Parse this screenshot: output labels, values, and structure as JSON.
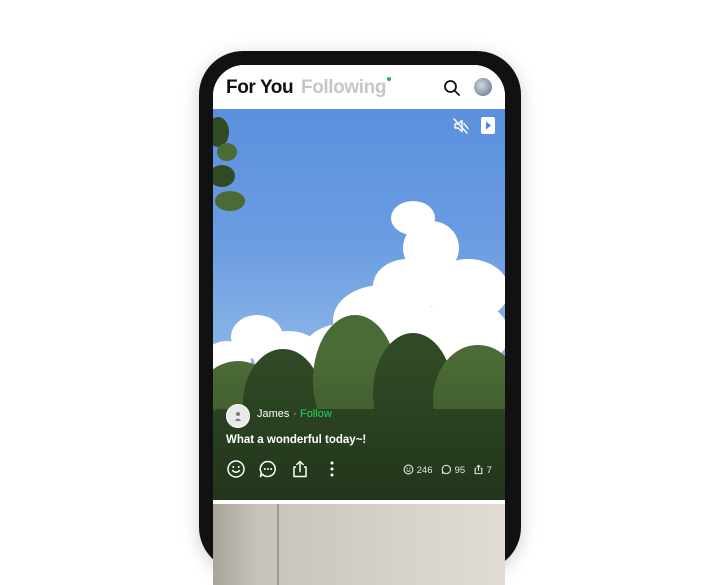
{
  "header": {
    "tabs": [
      {
        "label": "For You",
        "active": true
      },
      {
        "label": "Following",
        "active": false,
        "new_indicator": true
      }
    ],
    "search_icon": "search-icon",
    "avatar_icon": "profile-avatar"
  },
  "video": {
    "controls": {
      "mute_icon": "speaker-muted-icon",
      "play_icon": "play-icon"
    },
    "author": {
      "name": "James",
      "separator": "·",
      "follow_label": "Follow"
    },
    "caption": "What a wonderful today~!",
    "actions": [
      "smile-icon",
      "comment-icon",
      "share-icon",
      "more-icon"
    ],
    "stats": {
      "reactions": "246",
      "comments": "95",
      "shares": "7"
    }
  },
  "colors": {
    "accent": "#1ed760",
    "active_tab": "#111111",
    "inactive_tab": "#c7c7c7",
    "phone_frame": "#111111"
  }
}
